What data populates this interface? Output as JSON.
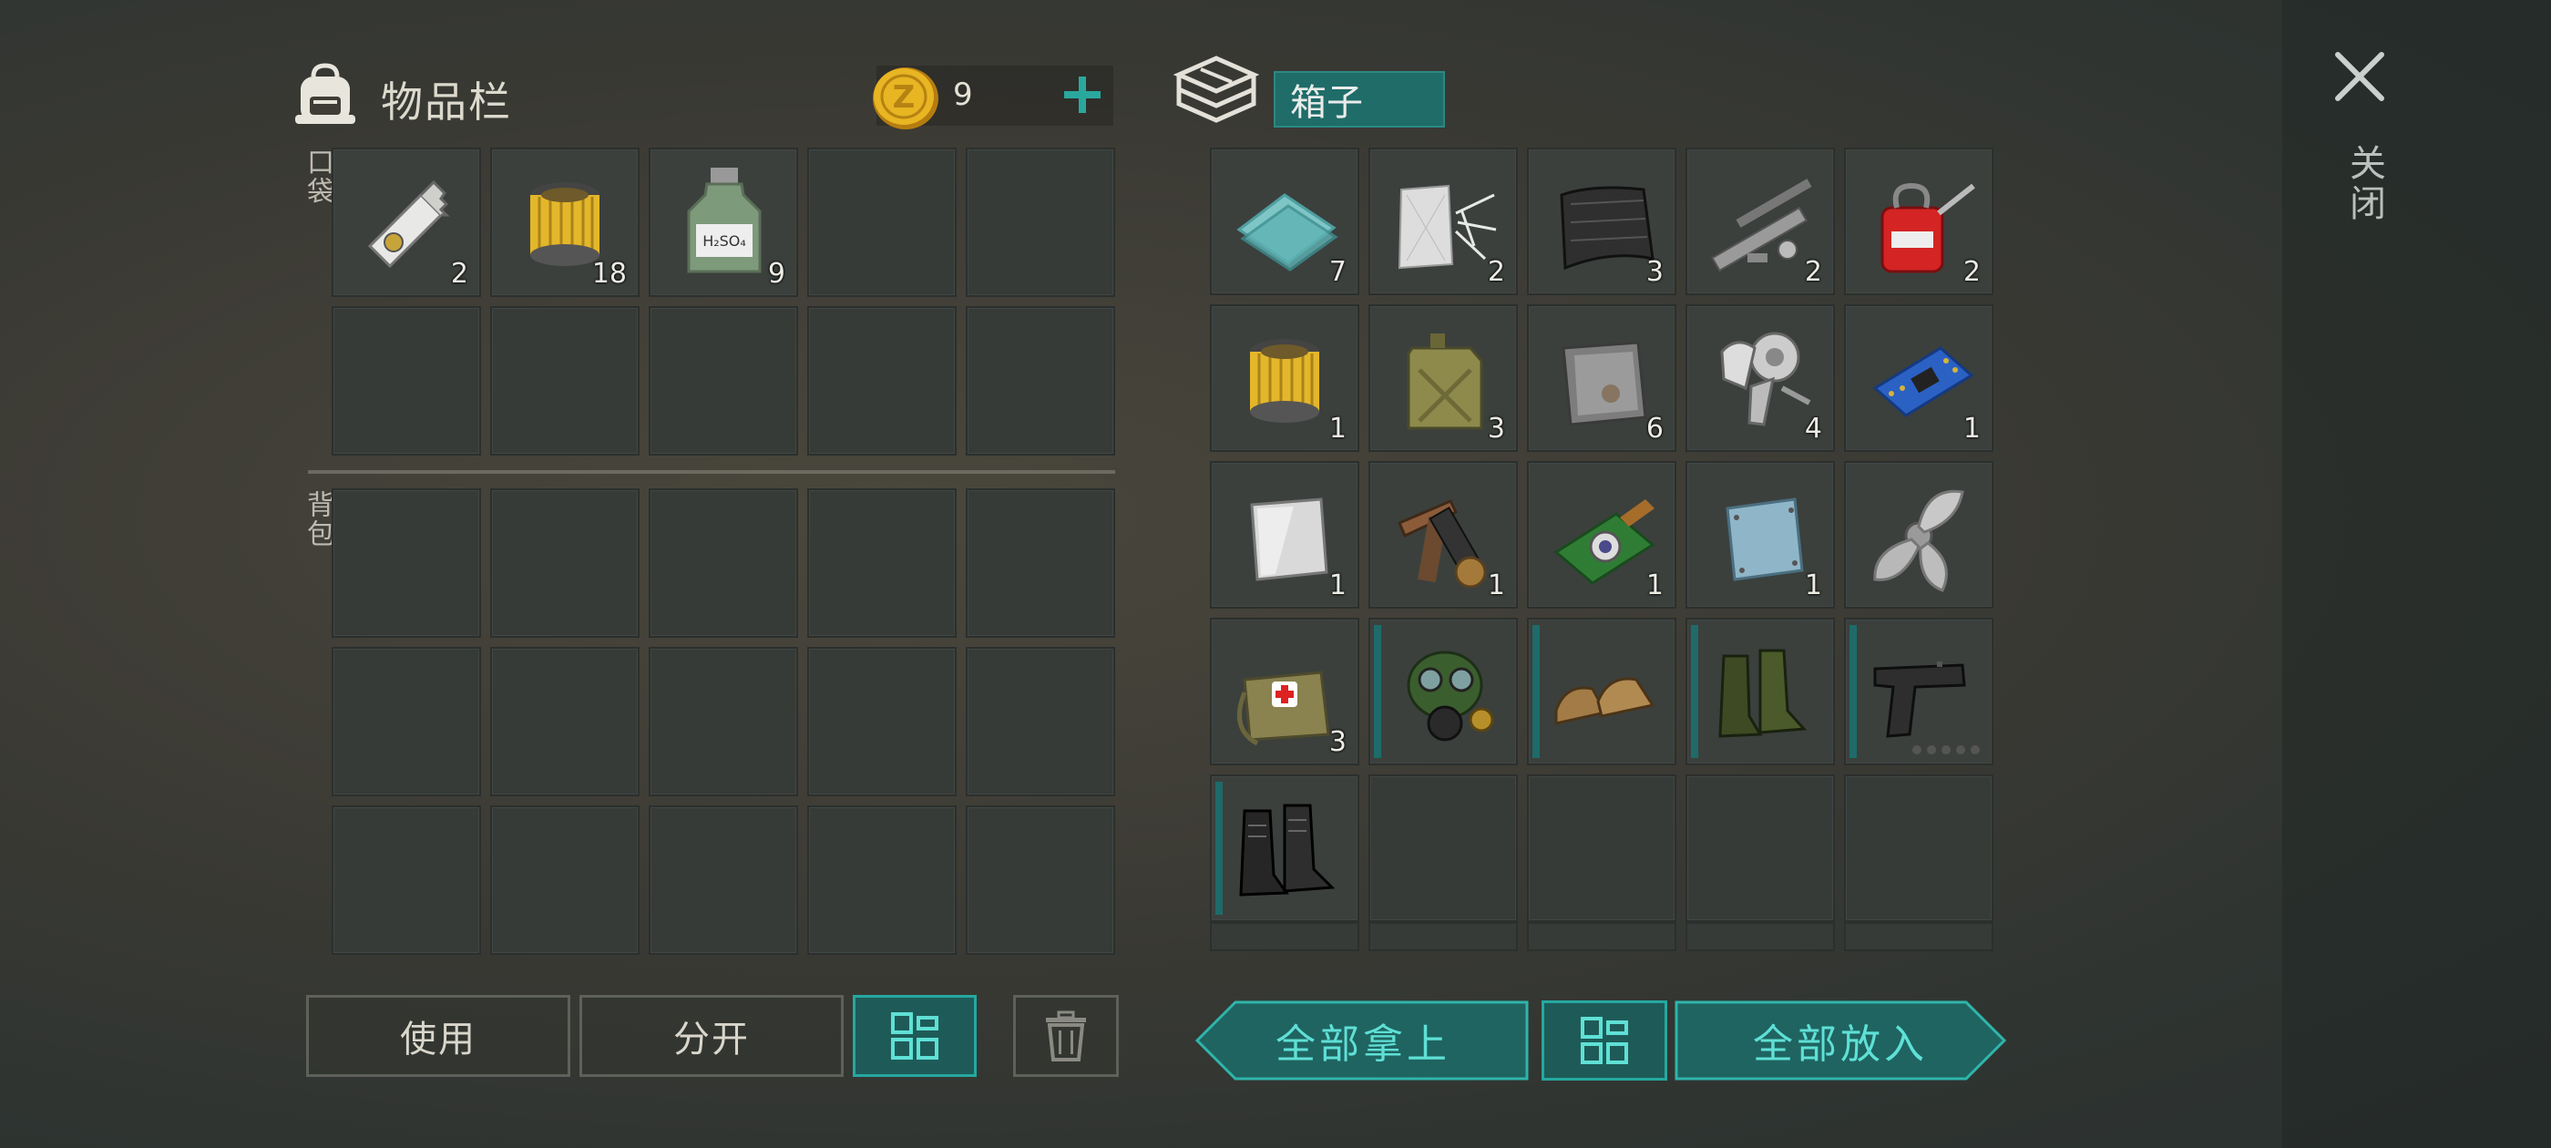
{
  "inventory": {
    "title": "物品栏",
    "coins": "9",
    "pocket_label": "口袋",
    "backpack_label": "背包",
    "pocket_slots": [
      {
        "item": "key-card-icon",
        "qty": "2"
      },
      {
        "item": "oil-filter-icon",
        "qty": "18"
      },
      {
        "item": "chemical-bottle-icon",
        "qty": "9",
        "bottle_label": "H₂SO₄"
      },
      {
        "item": "",
        "qty": ""
      },
      {
        "item": "",
        "qty": ""
      },
      {
        "item": "",
        "qty": ""
      },
      {
        "item": "",
        "qty": ""
      },
      {
        "item": "",
        "qty": ""
      },
      {
        "item": "",
        "qty": ""
      },
      {
        "item": "",
        "qty": ""
      }
    ]
  },
  "buttons": {
    "use": "使用",
    "split": "分开",
    "take_all": "全部拿上",
    "put_all": "全部放入"
  },
  "container": {
    "title": "箱子",
    "slots": [
      {
        "item": "glass-sheets-icon",
        "qty": "7"
      },
      {
        "item": "fiberglass-icon",
        "qty": "2"
      },
      {
        "item": "carbon-sheet-icon",
        "qty": "3"
      },
      {
        "item": "pipe-parts-icon",
        "qty": "2"
      },
      {
        "item": "oil-can-icon",
        "qty": "2"
      },
      {
        "item": "oil-filter-icon",
        "qty": "1"
      },
      {
        "item": "jerrycan-icon",
        "qty": "3"
      },
      {
        "item": "metal-plate-icon",
        "qty": "6"
      },
      {
        "item": "engine-parts-icon",
        "qty": "4"
      },
      {
        "item": "circuit-board-icon",
        "qty": "1"
      },
      {
        "item": "steel-sheet-icon",
        "qty": "1"
      },
      {
        "item": "tools-kit-icon",
        "qty": "1"
      },
      {
        "item": "camera-module-icon",
        "qty": "1"
      },
      {
        "item": "blue-plate-icon",
        "qty": "1"
      },
      {
        "item": "propeller-icon",
        "qty": ""
      },
      {
        "item": "medkit-bag-icon",
        "qty": "3"
      },
      {
        "item": "gas-mask-icon",
        "qty": "",
        "equip": true
      },
      {
        "item": "leather-shoes-icon",
        "qty": "",
        "equip": true
      },
      {
        "item": "rubber-boots-icon",
        "qty": "",
        "equip": true
      },
      {
        "item": "pistol-icon",
        "qty": "",
        "equip": true,
        "ammo": "0 of 5"
      },
      {
        "item": "combat-boots-icon",
        "qty": "",
        "equip": true
      },
      {
        "item": "",
        "qty": ""
      },
      {
        "item": "",
        "qty": ""
      },
      {
        "item": "",
        "qty": ""
      },
      {
        "item": "",
        "qty": ""
      }
    ]
  },
  "close": {
    "label": "关闭"
  },
  "colors": {
    "accent_teal": "#1f6c69",
    "accent_teal_text": "#5fe0d6",
    "coin_gold": "#e5b21f"
  }
}
